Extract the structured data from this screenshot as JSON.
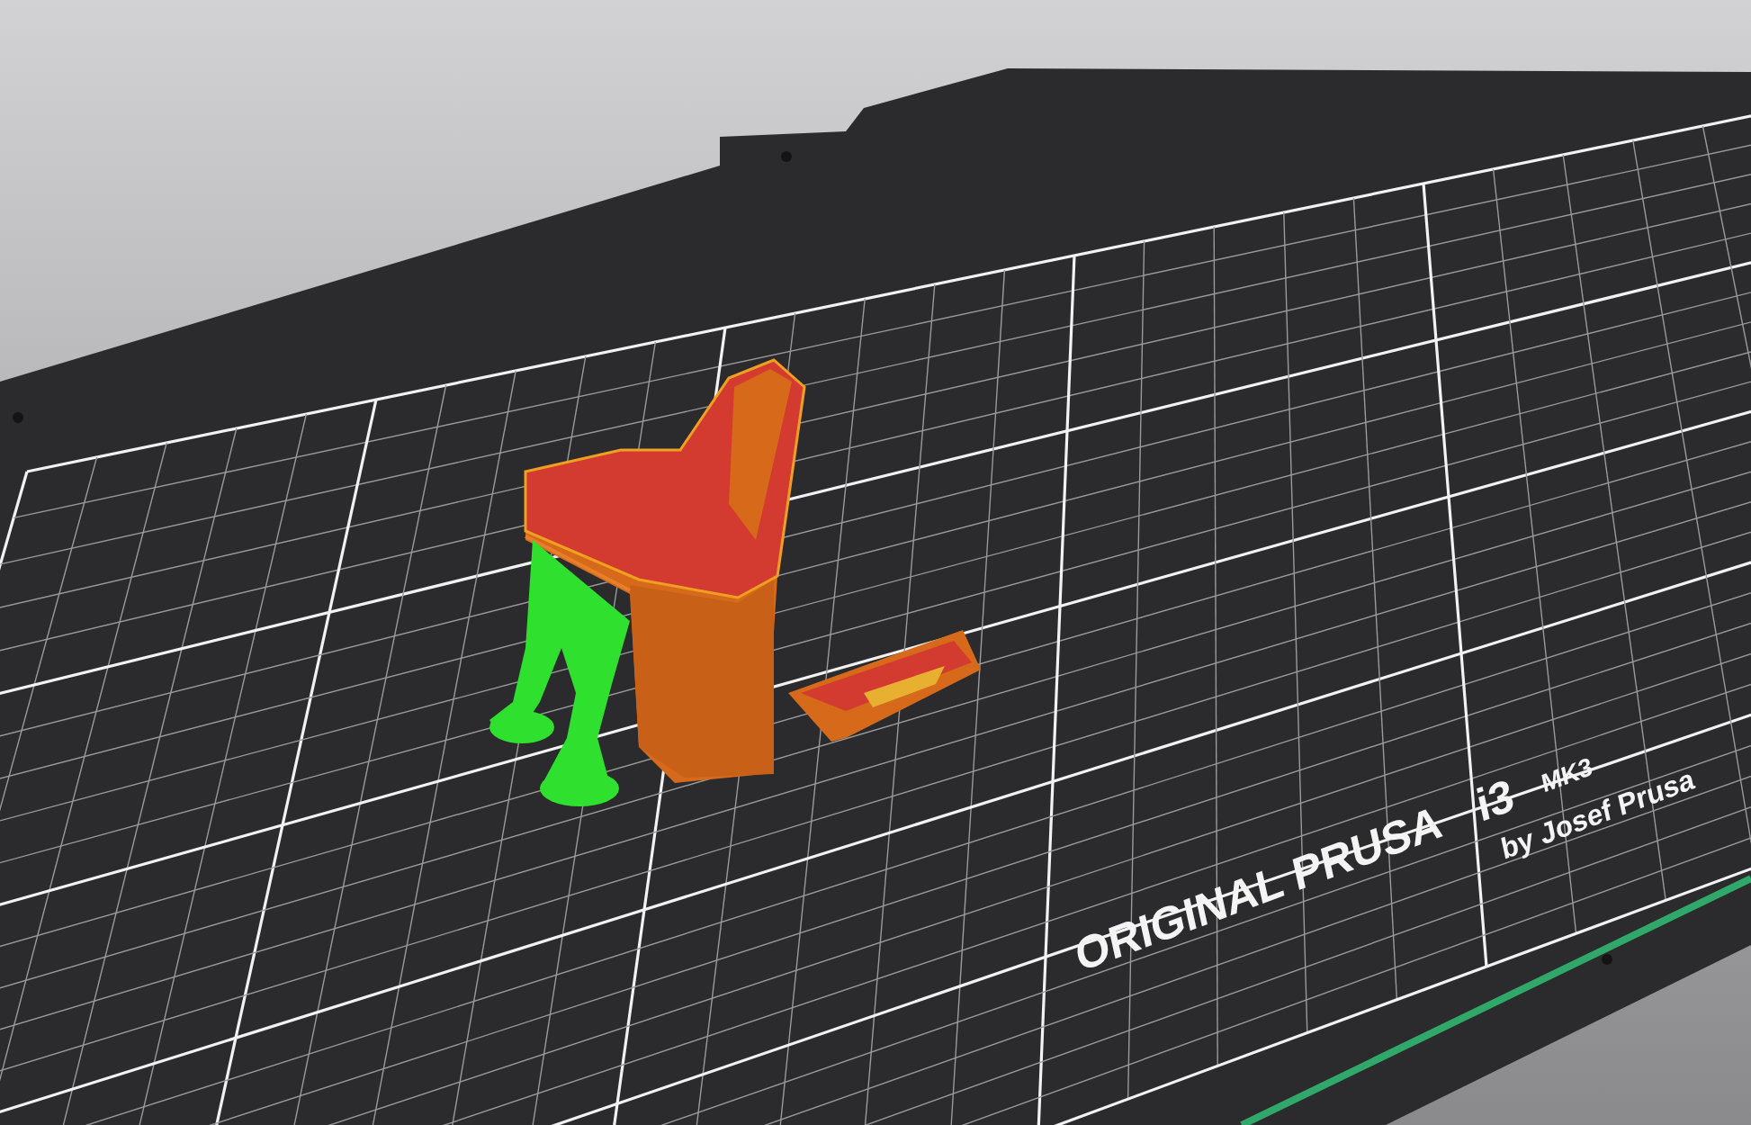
{
  "bed_label": {
    "brand": "ORIGINAL PRUSA",
    "model": "i3",
    "variant": "MK3",
    "credit": "by Josef Prusa"
  }
}
